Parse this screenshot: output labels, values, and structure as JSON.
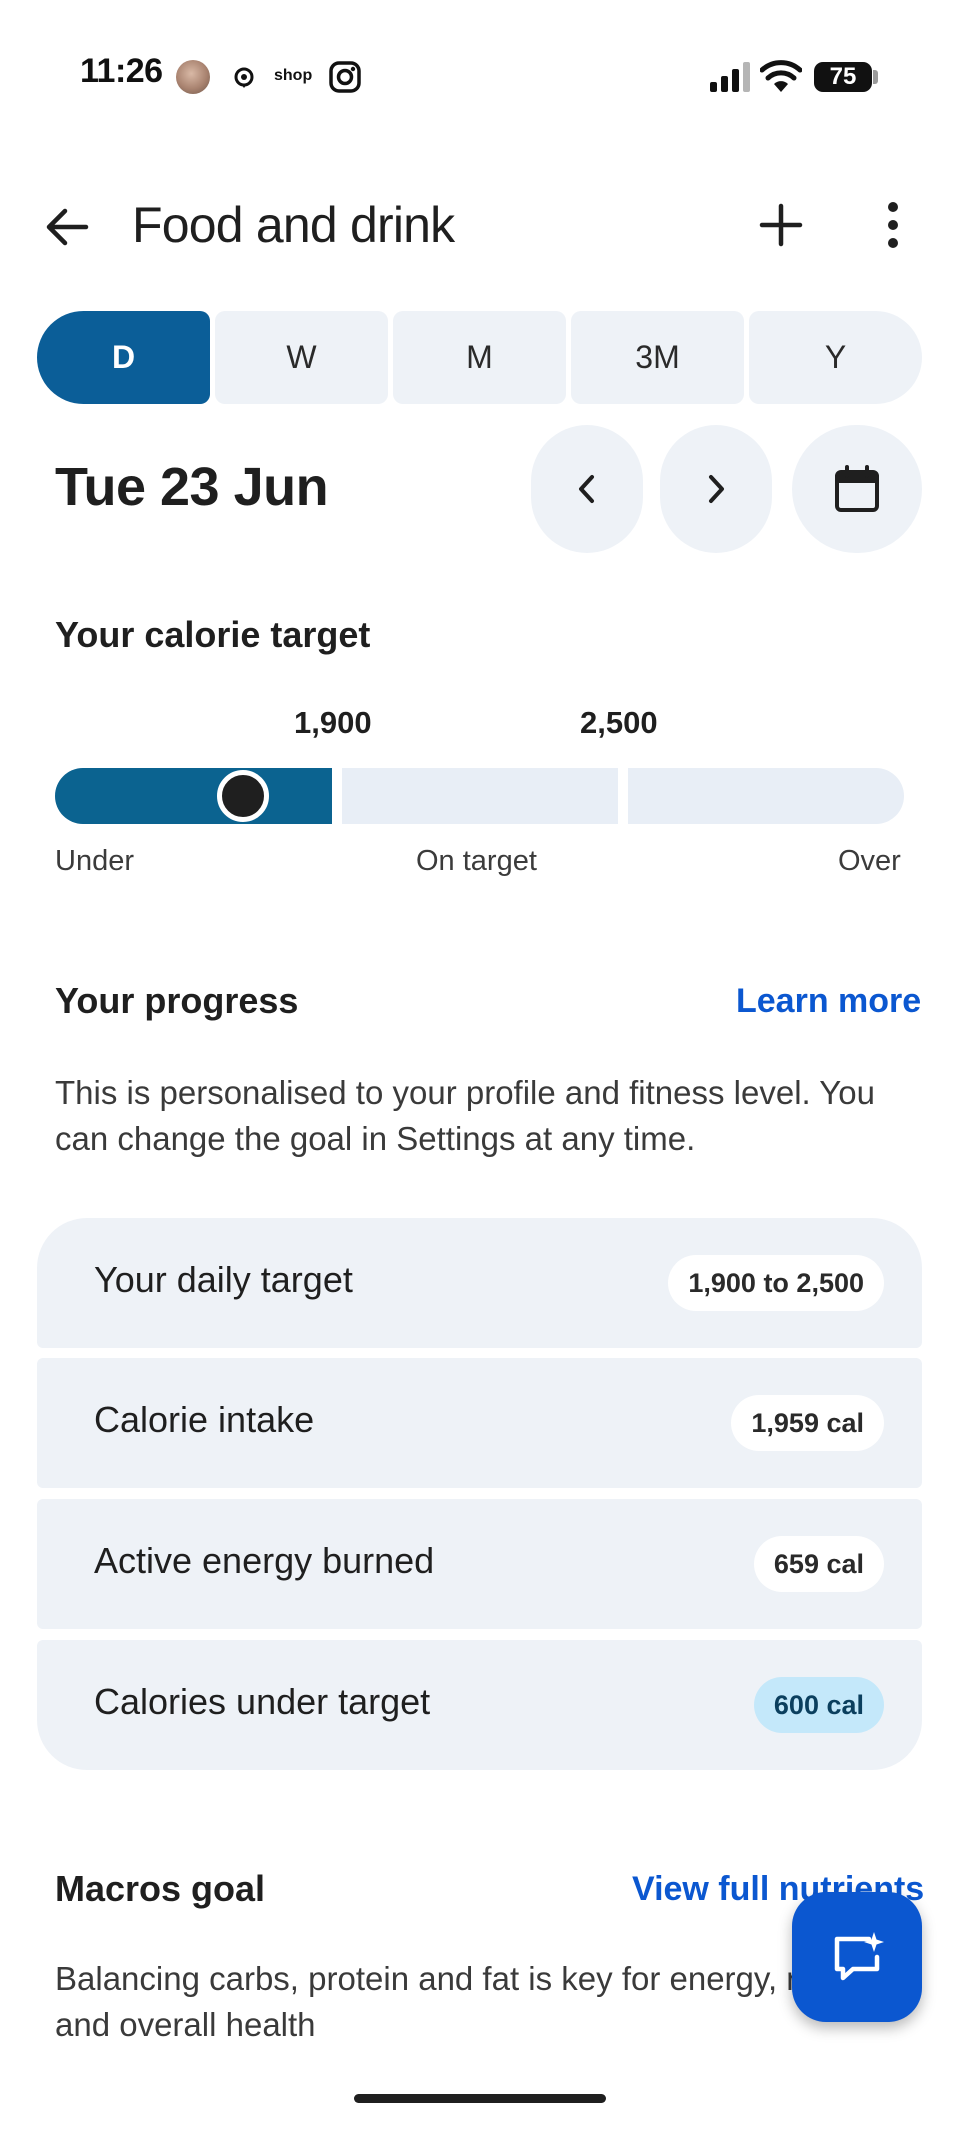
{
  "status_bar": {
    "time": "11:26",
    "shop_label": "shop",
    "battery": "75"
  },
  "header": {
    "title": "Food and drink"
  },
  "tabs": [
    {
      "label": "D",
      "active": true
    },
    {
      "label": "W",
      "active": false
    },
    {
      "label": "M",
      "active": false
    },
    {
      "label": "3M",
      "active": false
    },
    {
      "label": "Y",
      "active": false
    }
  ],
  "date": {
    "label": "Tue 23 Jun"
  },
  "calorie_target": {
    "heading": "Your calorie target",
    "lower": "1,900",
    "upper": "2,500",
    "marker_fraction": 0.68,
    "scale_labels": {
      "under": "Under",
      "on": "On target",
      "over": "Over"
    },
    "colors": {
      "fill": "#0b6390",
      "track": "#e8eef6"
    }
  },
  "progress": {
    "heading": "Your progress",
    "learn_more": "Learn more",
    "description": "This is personalised to your profile and fitness level. You can change the goal in Settings at any time.",
    "rows": [
      {
        "label": "Your daily target",
        "value": "1,900 to 2,500"
      },
      {
        "label": "Calorie intake",
        "value": "1,959 cal"
      },
      {
        "label": "Active energy burned",
        "value": "659 cal"
      },
      {
        "label": "Calories under target",
        "value": "600 cal"
      }
    ]
  },
  "macros": {
    "heading": "Macros goal",
    "link": "View full nutrients",
    "description": "Balancing carbs, protein and fat is key for energy, recovery and overall health"
  },
  "colors": {
    "accent": "#0b5e98",
    "link": "#0b57d0",
    "fab": "#0b57d0",
    "highlight_pill": "#c4e8fa",
    "card_bg": "#eef2f7"
  },
  "icons": {
    "back": "arrow-left-icon",
    "add": "plus-icon",
    "more": "more-vertical-icon",
    "prev": "chevron-left-icon",
    "next": "chevron-right-icon",
    "calendar": "calendar-icon",
    "fab": "ai-chat-icon"
  }
}
